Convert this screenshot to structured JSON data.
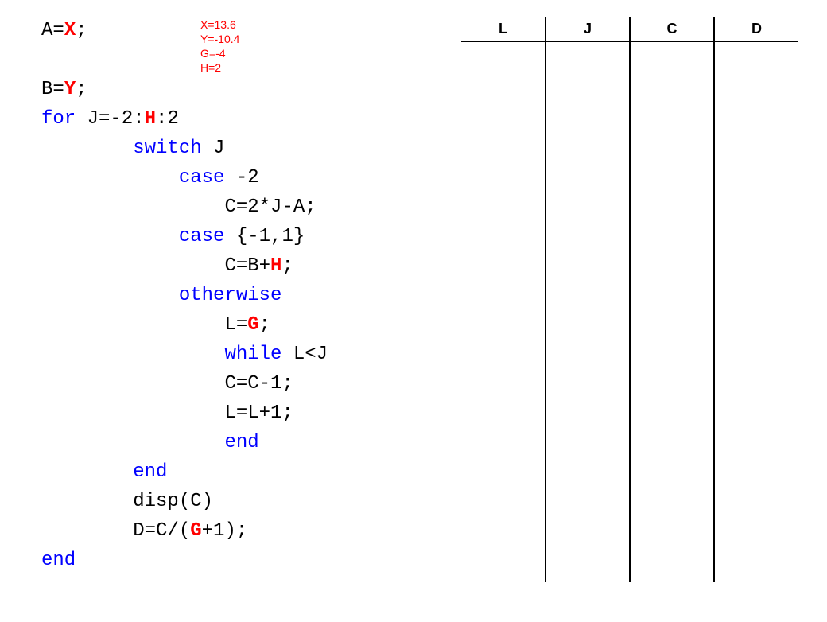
{
  "code": {
    "l1_a": "A=",
    "l1_x": "X",
    "l1_b": ";",
    "l2_a": "B=",
    "l2_y": "Y",
    "l2_b": ";",
    "l3_a": "for",
    "l3_b": " J=-2:",
    "l3_h": "H",
    "l3_c": ":2",
    "l4_a": "        ",
    "l4_sw": "switch",
    "l4_b": " J",
    "l5_a": "            ",
    "l5_cs": "case",
    "l5_b": " -2",
    "l6_a": "                C=2*J-A;",
    "l7_a": "            ",
    "l7_cs": "case",
    "l7_b": " {-1,1}",
    "l8_a": "                C=B+",
    "l8_h": "H",
    "l8_b": ";",
    "l9_a": "            ",
    "l9_ow": "otherwise",
    "l10_a": "                L=",
    "l10_g": "G",
    "l10_b": ";",
    "l11_a": "                ",
    "l11_wh": "while",
    "l11_b": " L<J",
    "l12_a": "                C=C-1;",
    "l13_a": "                L=L+1;",
    "l14_a": "                ",
    "l14_end": "end",
    "l15_a": "        ",
    "l15_end": "end",
    "l16_a": "        disp(C)",
    "l17_a": "        D=C/(",
    "l17_g": "G",
    "l17_b": "+1);",
    "l18_end": "end"
  },
  "annotation": {
    "x": "X=13.6",
    "y": "Y=-10.4",
    "g": "G=-4",
    "h": "H=2"
  },
  "table": {
    "headers": [
      "L",
      "J",
      "C",
      "D"
    ]
  }
}
